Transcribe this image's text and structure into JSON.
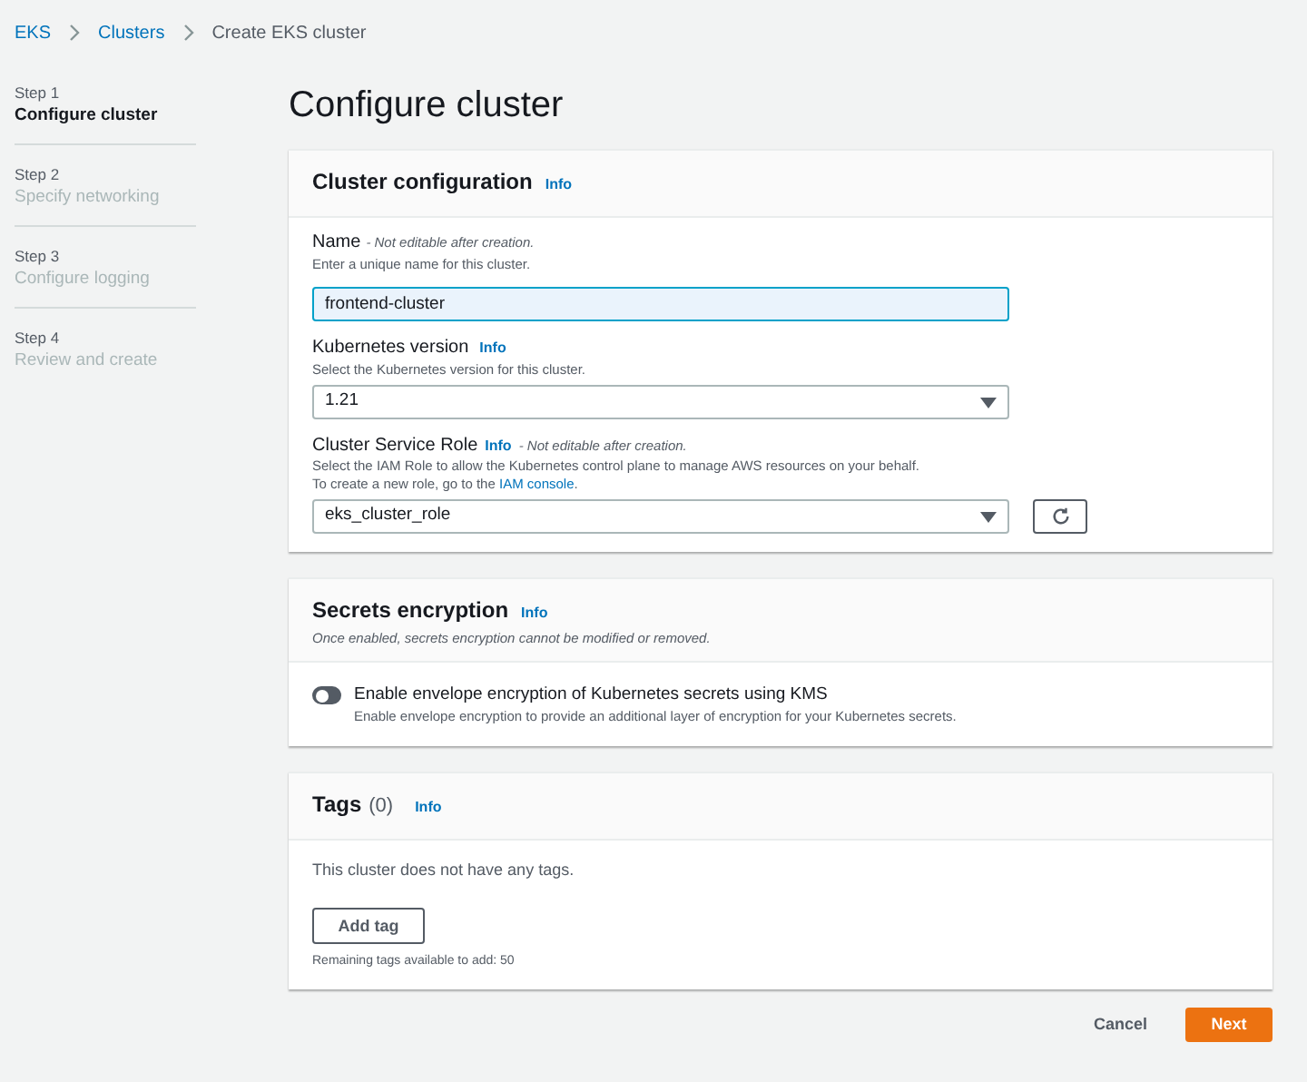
{
  "breadcrumbs": [
    {
      "label": "EKS",
      "link": true
    },
    {
      "label": "Clusters",
      "link": true
    },
    {
      "label": "Create EKS cluster",
      "link": false
    }
  ],
  "steps": [
    {
      "step": "Step 1",
      "label": "Configure cluster",
      "selected": true
    },
    {
      "step": "Step 2",
      "label": "Specify networking",
      "selected": false
    },
    {
      "step": "Step 3",
      "label": "Configure logging",
      "selected": false
    },
    {
      "step": "Step 4",
      "label": "Review and create",
      "selected": false
    }
  ],
  "page_title": "Configure cluster",
  "cluster_configuration": {
    "title": "Cluster configuration",
    "info": "Info",
    "name_field": {
      "label": "Name",
      "note": "- Not editable after creation.",
      "description": "Enter a unique name for this cluster.",
      "value": "frontend-cluster"
    },
    "version_field": {
      "label": "Kubernetes version",
      "info": "Info",
      "description": "Select the Kubernetes version for this cluster.",
      "value": "1.21"
    },
    "role_field": {
      "label": "Cluster Service Role",
      "info": "Info",
      "note": "- Not editable after creation.",
      "description": "Select the IAM Role to allow the Kubernetes control plane to manage AWS resources on your behalf.",
      "description_2": "To create a new role, go to the",
      "link": "IAM console",
      "link_end": ".",
      "value": "eks_cluster_role"
    }
  },
  "secrets_encryption": {
    "title": "Secrets encryption",
    "info": "Info",
    "description": "Once enabled, secrets encryption cannot be modified or removed.",
    "toggle": {
      "label": "Enable envelope encryption of Kubernetes secrets using KMS",
      "description": "Enable envelope encryption to provide an additional layer of encryption for your Kubernetes secrets.",
      "on": false
    }
  },
  "tags": {
    "title": "Tags",
    "count": "(0)",
    "info": "Info",
    "empty_text": "This cluster does not have any tags.",
    "add_button": "Add tag",
    "remaining": "Remaining tags available to add: 50"
  },
  "actions": {
    "cancel": "Cancel",
    "next": "Next"
  }
}
